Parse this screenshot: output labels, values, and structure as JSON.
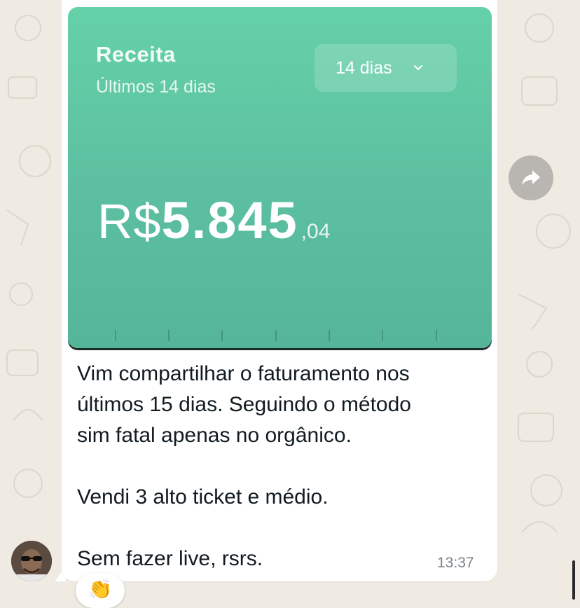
{
  "card": {
    "title": "Receita",
    "subtitle": "Últimos 14 dias",
    "period": "14 dias",
    "currency": "R$",
    "amount_integer": "5.845",
    "amount_cents": ",04",
    "bg_color": "#5fc6a3"
  },
  "message": {
    "lines": [
      "Vim compartilhar o faturamento nos",
      "últimos 15 dias. Seguindo o método",
      "sim fatal apenas no orgânico."
    ],
    "line2": "Vendi 3 alto ticket e médio.",
    "line3": "Sem fazer live, rsrs.",
    "time": "13:37"
  },
  "reaction": {
    "emoji": "👏"
  },
  "icons": {
    "forward": "forward-arrow-icon",
    "chevron": "chevron-down-icon"
  }
}
